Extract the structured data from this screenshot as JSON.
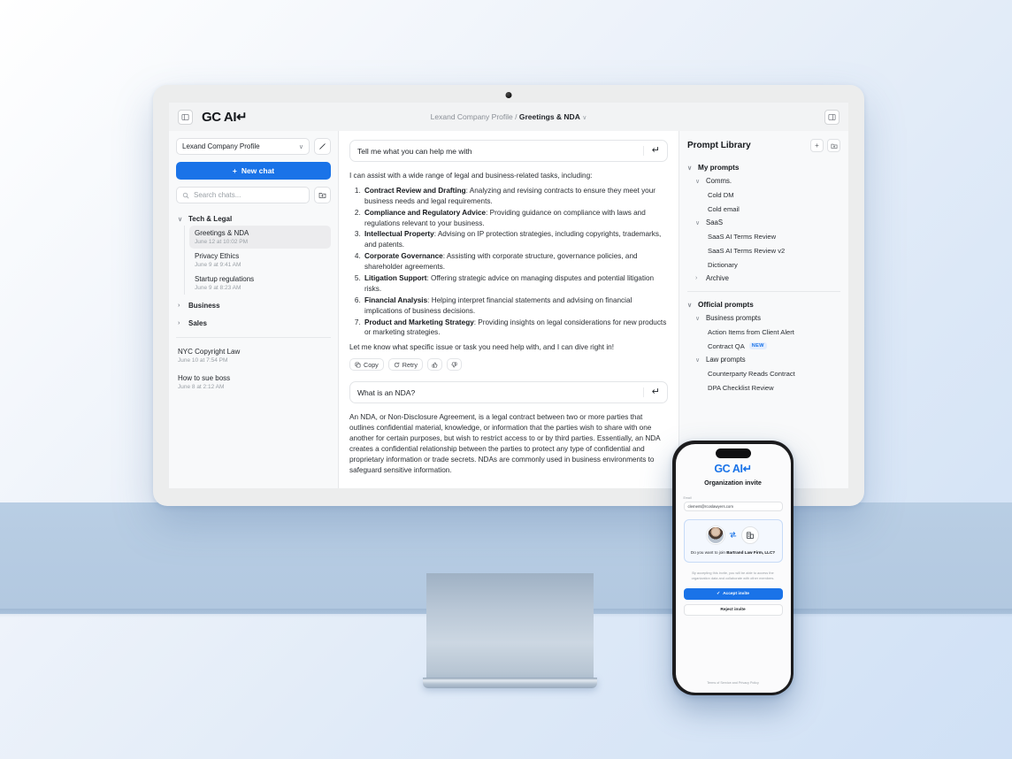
{
  "app": {
    "brand": "GC AI",
    "brand_glyph": "↵",
    "sidebar_toggle_icon": "panel-left-icon",
    "right_panel_icon": "panel-right-icon",
    "breadcrumb": {
      "parent": "Lexand Company Profile",
      "separator": "/",
      "current": "Greetings & NDA",
      "chevron": "∨"
    }
  },
  "sidebar": {
    "profile_selected": "Lexand Company Profile",
    "profile_chevron": "∨",
    "edit_icon": "pencil-icon",
    "new_chat_label": "New chat",
    "new_chat_plus": "+",
    "search_placeholder": "Search chats...",
    "search_icon": "search-icon",
    "new_folder_icon": "new-folder-icon",
    "groups": [
      {
        "name": "Tech & Legal",
        "expanded": true,
        "twisty": "∨",
        "chats": [
          {
            "title": "Greetings & NDA",
            "date": "June 12 at 10:02 PM",
            "active": true
          },
          {
            "title": "Privacy Ethics",
            "date": "June 9 at 9:41 AM",
            "active": false
          },
          {
            "title": "Startup regulations",
            "date": "June 9 at 8:23 AM",
            "active": false
          }
        ]
      },
      {
        "name": "Business",
        "expanded": false,
        "twisty": "›",
        "chats": []
      },
      {
        "name": "Sales",
        "expanded": false,
        "twisty": "›",
        "chats": []
      }
    ],
    "loose_chats": [
      {
        "title": "NYC Copyright Law",
        "date": "June 10 at 7:54 PM"
      },
      {
        "title": "How to sue boss",
        "date": "June 8 at 2:12 AM"
      }
    ]
  },
  "chat": {
    "messages": [
      {
        "role": "user",
        "text": "Tell me what you can help me with",
        "enter_glyph": "↵"
      },
      {
        "role": "assistant",
        "intro": "I can assist with a wide range of legal and business-related tasks, including:",
        "items": [
          {
            "title": "Contract Review and Drafting",
            "body": ": Analyzing and revising contracts to ensure they meet your business needs and legal requirements."
          },
          {
            "title": "Compliance and Regulatory Advice",
            "body": ": Providing guidance on compliance with laws and regulations relevant to your business."
          },
          {
            "title": "Intellectual Property",
            "body": ": Advising on IP protection strategies, including copyrights, trademarks, and patents."
          },
          {
            "title": "Corporate Governance",
            "body": ": Assisting with corporate structure, governance policies, and shareholder agreements."
          },
          {
            "title": "Litigation Support",
            "body": ": Offering strategic advice on managing disputes and potential litigation risks."
          },
          {
            "title": "Financial Analysis",
            "body": ": Helping interpret financial statements and advising on financial implications of business decisions."
          },
          {
            "title": "Product and Marketing Strategy",
            "body": ": Providing insights on legal considerations for new products or marketing strategies."
          }
        ],
        "outro": "Let me know what specific issue or task you need help with, and I can dive right in!"
      },
      {
        "role": "user",
        "text": "What is an NDA?",
        "enter_glyph": "↵"
      },
      {
        "role": "assistant",
        "paragraph": "An NDA, or Non-Disclosure Agreement, is a legal contract between two or more parties that outlines confidential material, knowledge, or information that the parties wish to share with one another for certain purposes, but wish to restrict access to or by third parties. Essentially, an NDA creates a confidential relationship between the parties to protect any type of confidential and proprietary information or trade secrets. NDAs are commonly used in business environments to safeguard sensitive information."
      }
    ],
    "actions": {
      "copy": "Copy",
      "retry": "Retry",
      "copy_icon": "copy-icon",
      "retry_icon": "refresh-icon",
      "thumbs_up_icon": "thumbs-up-icon",
      "thumbs_down_icon": "thumbs-down-icon"
    }
  },
  "library": {
    "title": "Prompt Library",
    "add_label": "+",
    "add_icon": "plus-icon",
    "new_folder_icon": "new-folder-icon",
    "sections": [
      {
        "name": "My prompts",
        "twisty": "∨",
        "subgroups": [
          {
            "name": "Comms.",
            "twisty": "∨",
            "items": [
              {
                "label": "Cold DM"
              },
              {
                "label": "Cold email"
              }
            ]
          },
          {
            "name": "SaaS",
            "twisty": "∨",
            "items": [
              {
                "label": "SaaS AI Terms Review"
              },
              {
                "label": "SaaS AI Terms Review v2"
              },
              {
                "label": "Dictionary"
              }
            ]
          },
          {
            "name": "Archive",
            "twisty": "›",
            "items": []
          }
        ]
      },
      {
        "name": "Official prompts",
        "twisty": "∨",
        "subgroups": [
          {
            "name": "Business prompts",
            "twisty": "∨",
            "items": [
              {
                "label": "Action Items from Client Alert"
              },
              {
                "label": "Contract QA",
                "badge": "NEW"
              }
            ]
          },
          {
            "name": "Law prompts",
            "twisty": "∨",
            "items": [
              {
                "label": "Counterparty Reads Contract"
              },
              {
                "label": "DPA Checklist Review"
              }
            ]
          }
        ]
      }
    ]
  },
  "phone": {
    "brand": "GC AI",
    "brand_glyph": "↵",
    "subtitle": "Organization invite",
    "email_label": "Email",
    "email_value": "clement@rcoslawyers.com",
    "avatar_icon": "user-avatar",
    "swap_icon": "swap-arrows-icon",
    "org_icon": "building-icon",
    "question_prefix": "Do you want to join ",
    "question_org": "Bartrand Law Firm, LLC?",
    "note": "By accepting this invite, you will be able to access the organization data and collaborate with other members.",
    "accept_label": "Accept invite",
    "accept_check": "✓",
    "reject_label": "Reject invite",
    "footer": "Terms of Service and Privacy Policy"
  },
  "colors": {
    "accent": "#1a73e8",
    "sidebar_bg": "#f8f9fa",
    "badge_blue": "#e3edfd"
  }
}
